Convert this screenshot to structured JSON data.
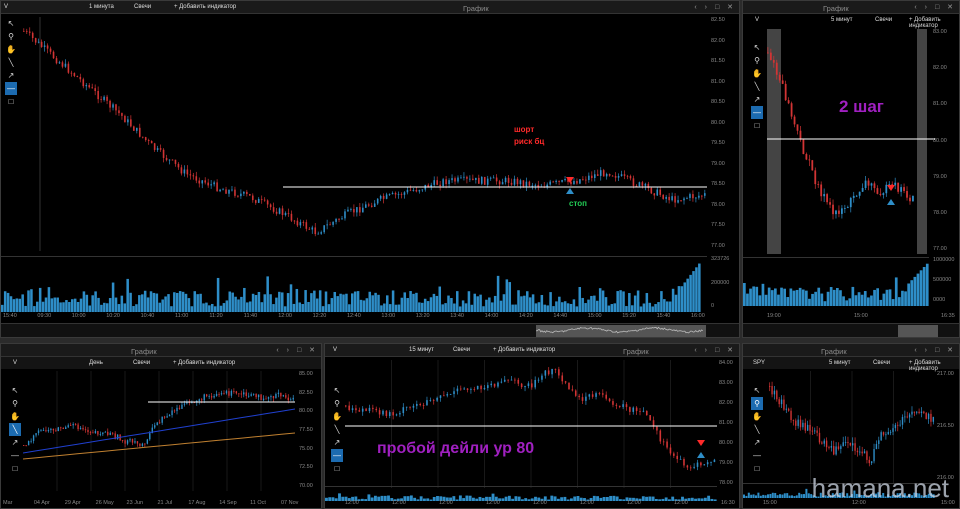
{
  "colors": {
    "up": "#2e8ec8",
    "down": "#d23434",
    "volume": "#2e8ec8",
    "level": "#ffffff",
    "bg": "#000000",
    "annotation_red": "#ff2a2a",
    "annotation_green": "#22cc55",
    "annotation_purple": "#a020c0"
  },
  "common": {
    "title": "График",
    "add_indicator": "+ Добавить индикатор",
    "chart_type": "Свечи",
    "window_controls": "‹ › □ ✕"
  },
  "tools": [
    "cursor-icon",
    "zoom-icon",
    "hand-icon",
    "line-icon",
    "arrow-icon",
    "hline-icon",
    "rect-icon"
  ],
  "panel_main": {
    "ticker": "V",
    "interval": "1 минута",
    "y_ticks": [
      "82.50",
      "82.00",
      "81.50",
      "81.00",
      "80.50",
      "80.00",
      "79.50",
      "79.00",
      "78.50",
      "78.00",
      "77.50",
      "77.00"
    ],
    "x_ticks": [
      "15:40",
      "09:30",
      "10:00",
      "10:20",
      "10:40",
      "11:00",
      "11:20",
      "11:40",
      "12:00",
      "12:20",
      "12:40",
      "13:00",
      "13:20",
      "13:40",
      "14:00",
      "14:20",
      "14:40",
      "15:00",
      "15:20",
      "15:40",
      "16:00"
    ],
    "price_tags": [
      "78.52",
      "78.37"
    ],
    "vol_ticks": [
      "323726",
      "200000",
      "0"
    ],
    "annotation_short": "шорт",
    "annotation_risk": "риск бц",
    "annotation_stop": "стоп"
  },
  "panel_right_top": {
    "ticker": "V",
    "interval": "5 минут",
    "y_ticks": [
      "83.00",
      "82.00",
      "81.00",
      "80.00",
      "79.00",
      "78.00",
      "77.00"
    ],
    "x_ticks": [
      "19:00",
      "15:00",
      "16:35"
    ],
    "price_tags": [
      "79.90",
      "78.52"
    ],
    "vol_ticks": [
      "1000000",
      "500000",
      "0000"
    ],
    "annotation": "2 шаг"
  },
  "panel_daily": {
    "ticker": "V",
    "interval": "День",
    "y_ticks": [
      "85.00",
      "82.50",
      "80.00",
      "77.50",
      "75.00",
      "72.50",
      "70.00"
    ],
    "x_ticks": [
      "Mar",
      "04 Apr",
      "29 Apr",
      "26 May",
      "23 Jun",
      "21 Jul",
      "17 Aug",
      "14 Sep",
      "11 Oct",
      "07 Nov"
    ],
    "price_tags": [
      "80.00",
      "78.26"
    ],
    "vol_ticks": [
      "2177729"
    ]
  },
  "panel_15m": {
    "ticker": "V",
    "interval": "15 минут",
    "y_ticks": [
      "84.00",
      "83.00",
      "82.00",
      "81.00",
      "80.00",
      "79.00",
      "78.00"
    ],
    "x_ticks": [
      "12:00",
      "12:00",
      "12:00",
      "12:00",
      "12:00",
      "12:00",
      "12:00",
      "12:00",
      "16:30"
    ],
    "price_tags": [
      "80.00",
      "78.52",
      "78.37"
    ],
    "vol_ticks": [
      "185000"
    ],
    "annotation": "пробой дейли ур 80"
  },
  "panel_spy": {
    "ticker": "SPY",
    "interval": "5 минут",
    "y_ticks": [
      "217.00",
      "216.50",
      "216.00"
    ],
    "x_ticks": [
      "15:00",
      "12:00",
      "15:00"
    ],
    "price_tags": [
      "216.57",
      "216.30"
    ],
    "vol_ticks": [
      "3634805"
    ]
  },
  "watermark": "hamana.net"
}
